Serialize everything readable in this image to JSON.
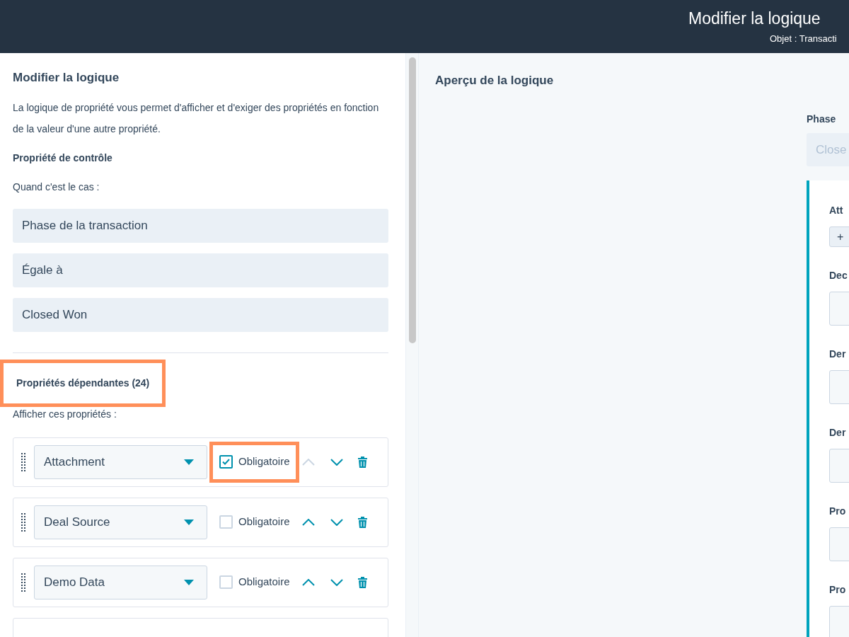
{
  "header": {
    "title": "Modifier la logique",
    "subtitle": "Objet : Transacti"
  },
  "editor": {
    "title": "Modifier la logique",
    "description": "La logique de propriété vous permet d'afficher et d'exiger des propriétés en fonction de la valeur d'une autre propriété.",
    "control_heading": "Propriété de contrôle",
    "control_label": "Quand c'est le cas :",
    "control_fields": [
      "Phase de la transaction",
      "Égale à",
      "Closed Won"
    ],
    "dependent_heading": {
      "text": "Propriétés dépendantes (24)",
      "highlighted": true
    },
    "dependent_label": "Afficher ces propriétés :",
    "rows": [
      {
        "property": "Attachment",
        "required_label": "Obligatoire",
        "checked": true,
        "highlighted": true,
        "up_disabled": true
      },
      {
        "property": "Deal Source",
        "required_label": "Obligatoire",
        "checked": false,
        "highlighted": false,
        "up_disabled": false
      },
      {
        "property": "Demo Data",
        "required_label": "Obligatoire",
        "checked": false,
        "highlighted": false,
        "up_disabled": false
      }
    ]
  },
  "preview": {
    "title": "Aperçu de la logique",
    "control_label": "Phase",
    "control_value": "Close",
    "fields": [
      {
        "kind": "upload",
        "label": "Att",
        "button": "+"
      },
      {
        "kind": "input",
        "label": "Dec"
      },
      {
        "kind": "input",
        "label": "Der"
      },
      {
        "kind": "input",
        "label": "Der"
      },
      {
        "kind": "input",
        "label": "Pro"
      },
      {
        "kind": "input",
        "label": "Pro"
      }
    ]
  }
}
